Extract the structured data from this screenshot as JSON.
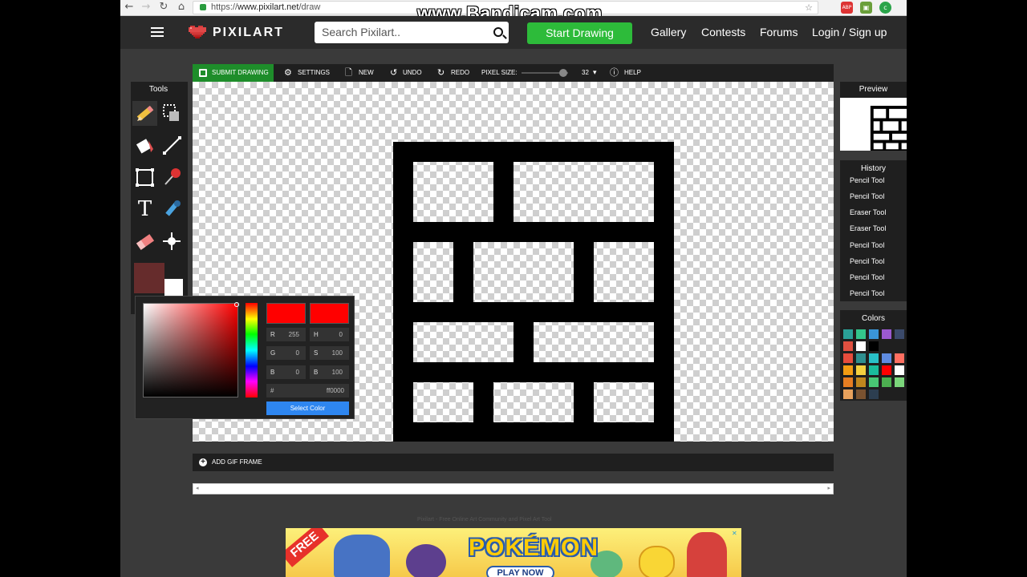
{
  "browser": {
    "url_prefix": "https://",
    "url_domain": "www.pixilart.net",
    "url_path": "/draw",
    "recording_watermark": "www.Bandicam.com",
    "back_icon": "←",
    "forward_icon": "→",
    "reload_icon": "↻",
    "home_icon": "⌂",
    "star_icon": "☆",
    "ext_abp": "ABP",
    "ext_2": "▣",
    "ext_3": "c"
  },
  "header": {
    "logo_text": "PIXILART",
    "search_placeholder": "Search Pixilart..",
    "start_button": "Start Drawing",
    "nav": [
      "Gallery",
      "Contests",
      "Forums",
      "Login / Sign up"
    ]
  },
  "toolbar": {
    "submit": "SUBMIT DRAWING",
    "settings": "SETTINGS",
    "new": "NEW",
    "undo": "UNDO",
    "redo": "REDO",
    "pixel_size_label": "PIXEL SIZE:",
    "pixel_size_value": "32",
    "help": "HELP",
    "settings_icon": "⚙",
    "new_icon": "🗋",
    "undo_icon": "↺",
    "redo_icon": "↻",
    "help_icon": "ⓘ",
    "dropdown_icon": "▾",
    "pixel_size_fraction": 0.9
  },
  "tools": {
    "title": "Tools",
    "items": [
      "pencil",
      "select",
      "fill-bucket",
      "line",
      "rectangle",
      "push-pin",
      "text",
      "eyedropper",
      "eraser",
      "dither"
    ],
    "text_tool_glyph": "T",
    "primary_color": "#662c2c",
    "secondary_color": "#ffffff"
  },
  "color_picker": {
    "r_label": "R",
    "r_value": "255",
    "g_label": "G",
    "g_value": "0",
    "b_label": "B",
    "b_value": "0",
    "h_label": "H",
    "h_value": "0",
    "s_label": "S",
    "s_value": "100",
    "v_label": "B",
    "v_value": "100",
    "hex_label": "#",
    "hex_value": "ff0000",
    "select_button": "Select Color",
    "new_color": "#ff0000",
    "current_color": "#ff0000",
    "spinner_glyph": "⇕"
  },
  "gif": {
    "add_frame": "ADD GIF FRAME",
    "plus_glyph": "+"
  },
  "scroll": {
    "left_arrow": "◂",
    "right_arrow": "▸"
  },
  "footer": {
    "note": "Pixilart - Free Online Art Community and Pixel Art Tool"
  },
  "ad": {
    "badge": "FREE",
    "brand": "POKÉMON",
    "cta": "PLAY NOW",
    "close_icon": "✕"
  },
  "preview": {
    "title": "Preview"
  },
  "history": {
    "title": "History",
    "items": [
      "Pencil Tool",
      "Pencil Tool",
      "Eraser Tool",
      "Eraser Tool",
      "Pencil Tool",
      "Pencil Tool",
      "Pencil Tool",
      "Pencil Tool"
    ]
  },
  "colors": {
    "title": "Colors",
    "swatches": [
      "#2aa198",
      "#33c58c",
      "#3a95d8",
      "#9b59d0",
      "#3b4a6b",
      "#f1c40f",
      "#e05040",
      "#ffffff",
      "#000000",
      "#e74c3c",
      "#2f8f8f",
      "#29c0c8",
      "#5e8be0",
      "#ff6f61",
      "#f5a623",
      "#f39c12",
      "#f4d03f",
      "#1abc9c",
      "#ff0000",
      "#ffffff",
      "#e67e22",
      "#c0871e",
      "#48c774",
      "#4caf50",
      "#7bd67b",
      "#e8a15c",
      "#7a5230",
      "#2c3e50"
    ]
  }
}
